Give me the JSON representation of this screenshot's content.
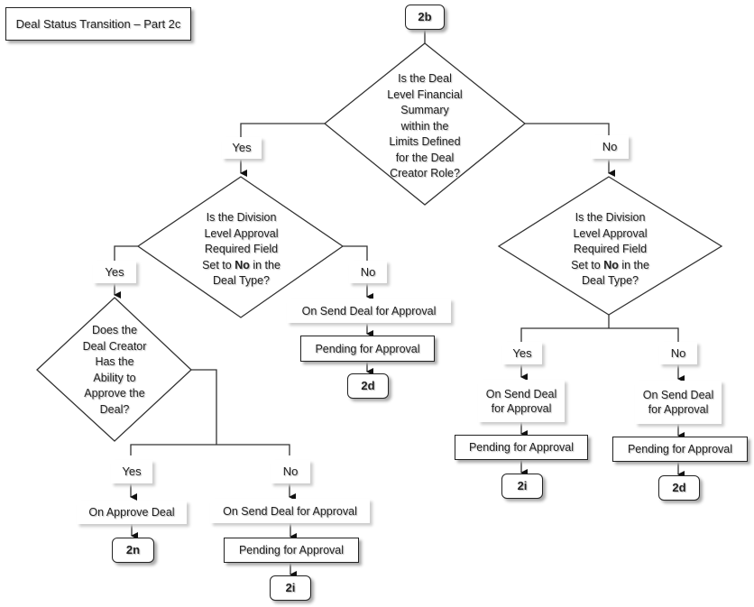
{
  "title": "Deal Status Transition – Part 2c",
  "connectors": {
    "start": "2b",
    "end_left_2n": "2n",
    "end_left_2i": "2i",
    "end_mid_2d": "2d",
    "end_right_2i": "2i",
    "end_right_2d": "2d"
  },
  "decisions": {
    "d1": [
      "Is the Deal",
      "Level Financial",
      "Summary",
      "within the",
      "Limits Defined",
      "for the Deal",
      "Creator Role?"
    ],
    "d2": {
      "line1": "Is the Division",
      "line2": "Level Approval",
      "line3": "Required Field",
      "line4_pre": "Set to ",
      "line4_bold": "No",
      "line4_post": " in the",
      "line5": "Deal Type?"
    },
    "d3": {
      "line1": "Is the Division",
      "line2": "Level Approval",
      "line3": "Required Field",
      "line4_pre": "Set to ",
      "line4_bold": "No",
      "line4_post": " in the",
      "line5": "Deal Type?"
    },
    "d4": [
      "Does the",
      "Deal Creator",
      "Has the",
      "Ability to",
      "Approve the",
      "Deal?"
    ]
  },
  "labels": {
    "yes": "Yes",
    "no": "No"
  },
  "events": {
    "send_for_approval": "On Send Deal for Approval",
    "send_for_approval_l1": "On Send Deal",
    "send_for_approval_l2": "for Approval",
    "approve": "On Approve Deal"
  },
  "states": {
    "pending": "Pending for Approval"
  }
}
